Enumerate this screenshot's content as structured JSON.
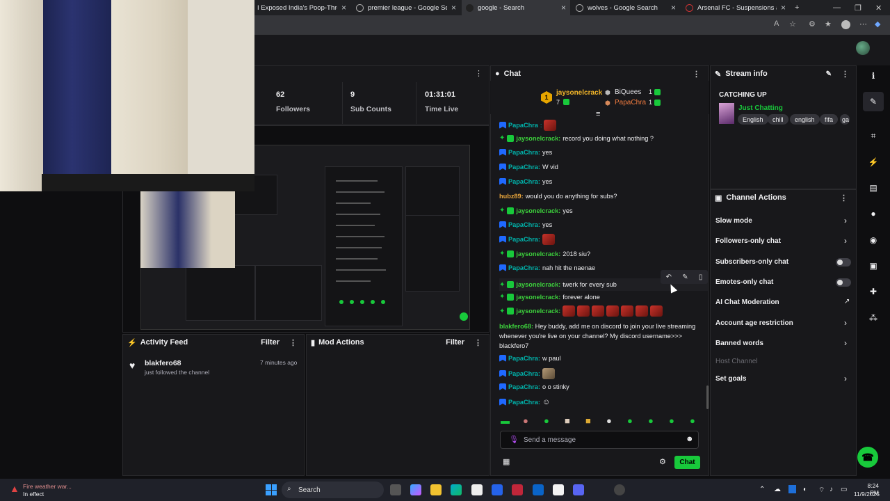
{
  "browser": {
    "tabs": [
      {
        "label": "I Exposed India's Poop-Throwing"
      },
      {
        "label": "premier league - Google Search"
      },
      {
        "label": "google - Search"
      },
      {
        "label": "wolves - Google Search"
      },
      {
        "label": "Arsenal FC - Suspensions and Inj"
      }
    ],
    "new_tab": "+",
    "win_min": "—",
    "win_max": "❐",
    "win_close": "✕"
  },
  "stats": {
    "followers_value": "62",
    "followers_label": "Followers",
    "subs_value": "9",
    "subs_label": "Sub Counts",
    "time_value": "01:31:01",
    "time_label": "Time Live"
  },
  "activity_feed": {
    "title": "Activity Feed",
    "filter": "Filter",
    "items": [
      {
        "name": "blakfero68",
        "action": "just followed the channel",
        "time": "7 minutes ago"
      }
    ]
  },
  "mod_actions": {
    "title": "Mod Actions",
    "filter": "Filter"
  },
  "chat": {
    "title": "Chat",
    "leaderboard": {
      "top_name": "jaysonelcrack",
      "top_count": "7",
      "rank": "1",
      "second_name": "BiQuees",
      "second_count": "1",
      "third_name": "PapaChra",
      "third_count": "1"
    },
    "messages": [
      {
        "user": "PapaChra",
        "text": ""
      },
      {
        "user": "jaysonelcrack:",
        "text": "record you doing what nothing ?"
      },
      {
        "user": "PapaChra:",
        "text": "yes"
      },
      {
        "user": "PapaChra:",
        "text": "W vid"
      },
      {
        "user": "PapaChra:",
        "text": "yes"
      },
      {
        "user": "hubz89:",
        "text": "would you do anything for subs?"
      },
      {
        "user": "jaysonelcrack:",
        "text": "yes"
      },
      {
        "user": "PapaChra:",
        "text": "yes"
      },
      {
        "user": "PapaChra:",
        "text": ""
      },
      {
        "user": "jaysonelcrack:",
        "text": "2018 siu?"
      },
      {
        "user": "PapaChra:",
        "text": "nah hit the naenae"
      },
      {
        "user": "jaysonelcrack:",
        "text": "twerk for every sub"
      },
      {
        "user": "jaysonelcrack:",
        "text": "forever alone"
      },
      {
        "user": "jaysonelcrack:",
        "text": ""
      },
      {
        "user": "PapaChra:",
        "text": "w paul"
      },
      {
        "user": "PapaChra:",
        "text": ""
      },
      {
        "user": "PapaChra:",
        "text": "o o stinky"
      },
      {
        "user": "PapaChra:",
        "text": ""
      }
    ],
    "long_message": {
      "user": "blakfero68:",
      "text": "Hey buddy, add me on discord to join your live streaming whenever you're live on your channel? My discord username>>> blackfero7"
    },
    "input_placeholder": "Send a message",
    "send_label": "Chat"
  },
  "stream_info": {
    "title": "Stream info",
    "stream_title": "CATCHING UP",
    "category": "Just Chatting",
    "tags": [
      "English",
      "chill",
      "english",
      "fifa",
      "ga"
    ]
  },
  "channel_actions": {
    "title": "Channel Actions",
    "items": [
      {
        "label": "Slow mode"
      },
      {
        "label": "Followers-only chat"
      },
      {
        "label": "Subscribers-only chat"
      },
      {
        "label": "Emotes-only chat"
      },
      {
        "label": "AI Chat Moderation"
      },
      {
        "label": "Account age restriction"
      },
      {
        "label": "Banned words"
      },
      {
        "label": "Host Channel"
      },
      {
        "label": "Set goals"
      }
    ]
  },
  "taskbar": {
    "weather_line1": "Fire weather war...",
    "weather_line2": "In effect",
    "search": "Search",
    "time": "8:24 PM",
    "date": "11/9/2025"
  }
}
